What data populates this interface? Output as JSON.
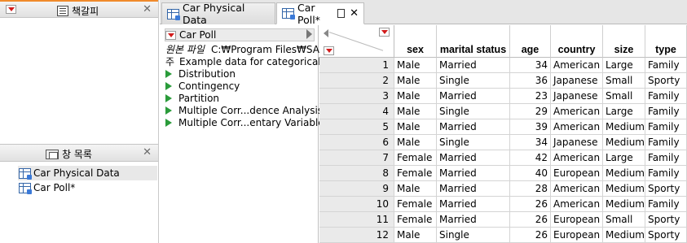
{
  "bookmarks": {
    "title": "책갈피"
  },
  "windowlist": {
    "title": "창 목록",
    "items": [
      {
        "label": "Car Physical Data"
      },
      {
        "label": "Car Poll*"
      }
    ]
  },
  "tabs": [
    {
      "label": "Car Physical Data"
    },
    {
      "label": "Car Poll*"
    }
  ],
  "tablepanel": {
    "title": "Car Poll",
    "source_label": "원본 파일",
    "source_path": "C:₩Program Files₩SAS",
    "notes_label": "주",
    "notes_text": "Example data for categorical d",
    "scripts": [
      {
        "label": "Distribution"
      },
      {
        "label": "Contingency"
      },
      {
        "label": "Partition"
      },
      {
        "label": "Multiple Corr...dence Analysis"
      },
      {
        "label": "Multiple Corr...entary Variable"
      }
    ]
  },
  "grid": {
    "columns": [
      "sex",
      "marital status",
      "age",
      "country",
      "size",
      "type"
    ],
    "rows": [
      [
        "1",
        "Male",
        "Married",
        "34",
        "American",
        "Large",
        "Family"
      ],
      [
        "2",
        "Male",
        "Single",
        "36",
        "Japanese",
        "Small",
        "Sporty"
      ],
      [
        "3",
        "Male",
        "Married",
        "23",
        "Japanese",
        "Small",
        "Family"
      ],
      [
        "4",
        "Male",
        "Single",
        "29",
        "American",
        "Large",
        "Family"
      ],
      [
        "5",
        "Male",
        "Married",
        "39",
        "American",
        "Medium",
        "Family"
      ],
      [
        "6",
        "Male",
        "Single",
        "34",
        "Japanese",
        "Medium",
        "Family"
      ],
      [
        "7",
        "Female",
        "Married",
        "42",
        "American",
        "Large",
        "Family"
      ],
      [
        "8",
        "Female",
        "Married",
        "40",
        "European",
        "Medium",
        "Family"
      ],
      [
        "9",
        "Male",
        "Married",
        "28",
        "American",
        "Medium",
        "Sporty"
      ],
      [
        "10",
        "Female",
        "Married",
        "26",
        "American",
        "Medium",
        "Family"
      ],
      [
        "11",
        "Female",
        "Married",
        "26",
        "European",
        "Small",
        "Sporty"
      ],
      [
        "12",
        "Male",
        "Single",
        "26",
        "European",
        "Medium",
        "Sporty"
      ]
    ]
  }
}
